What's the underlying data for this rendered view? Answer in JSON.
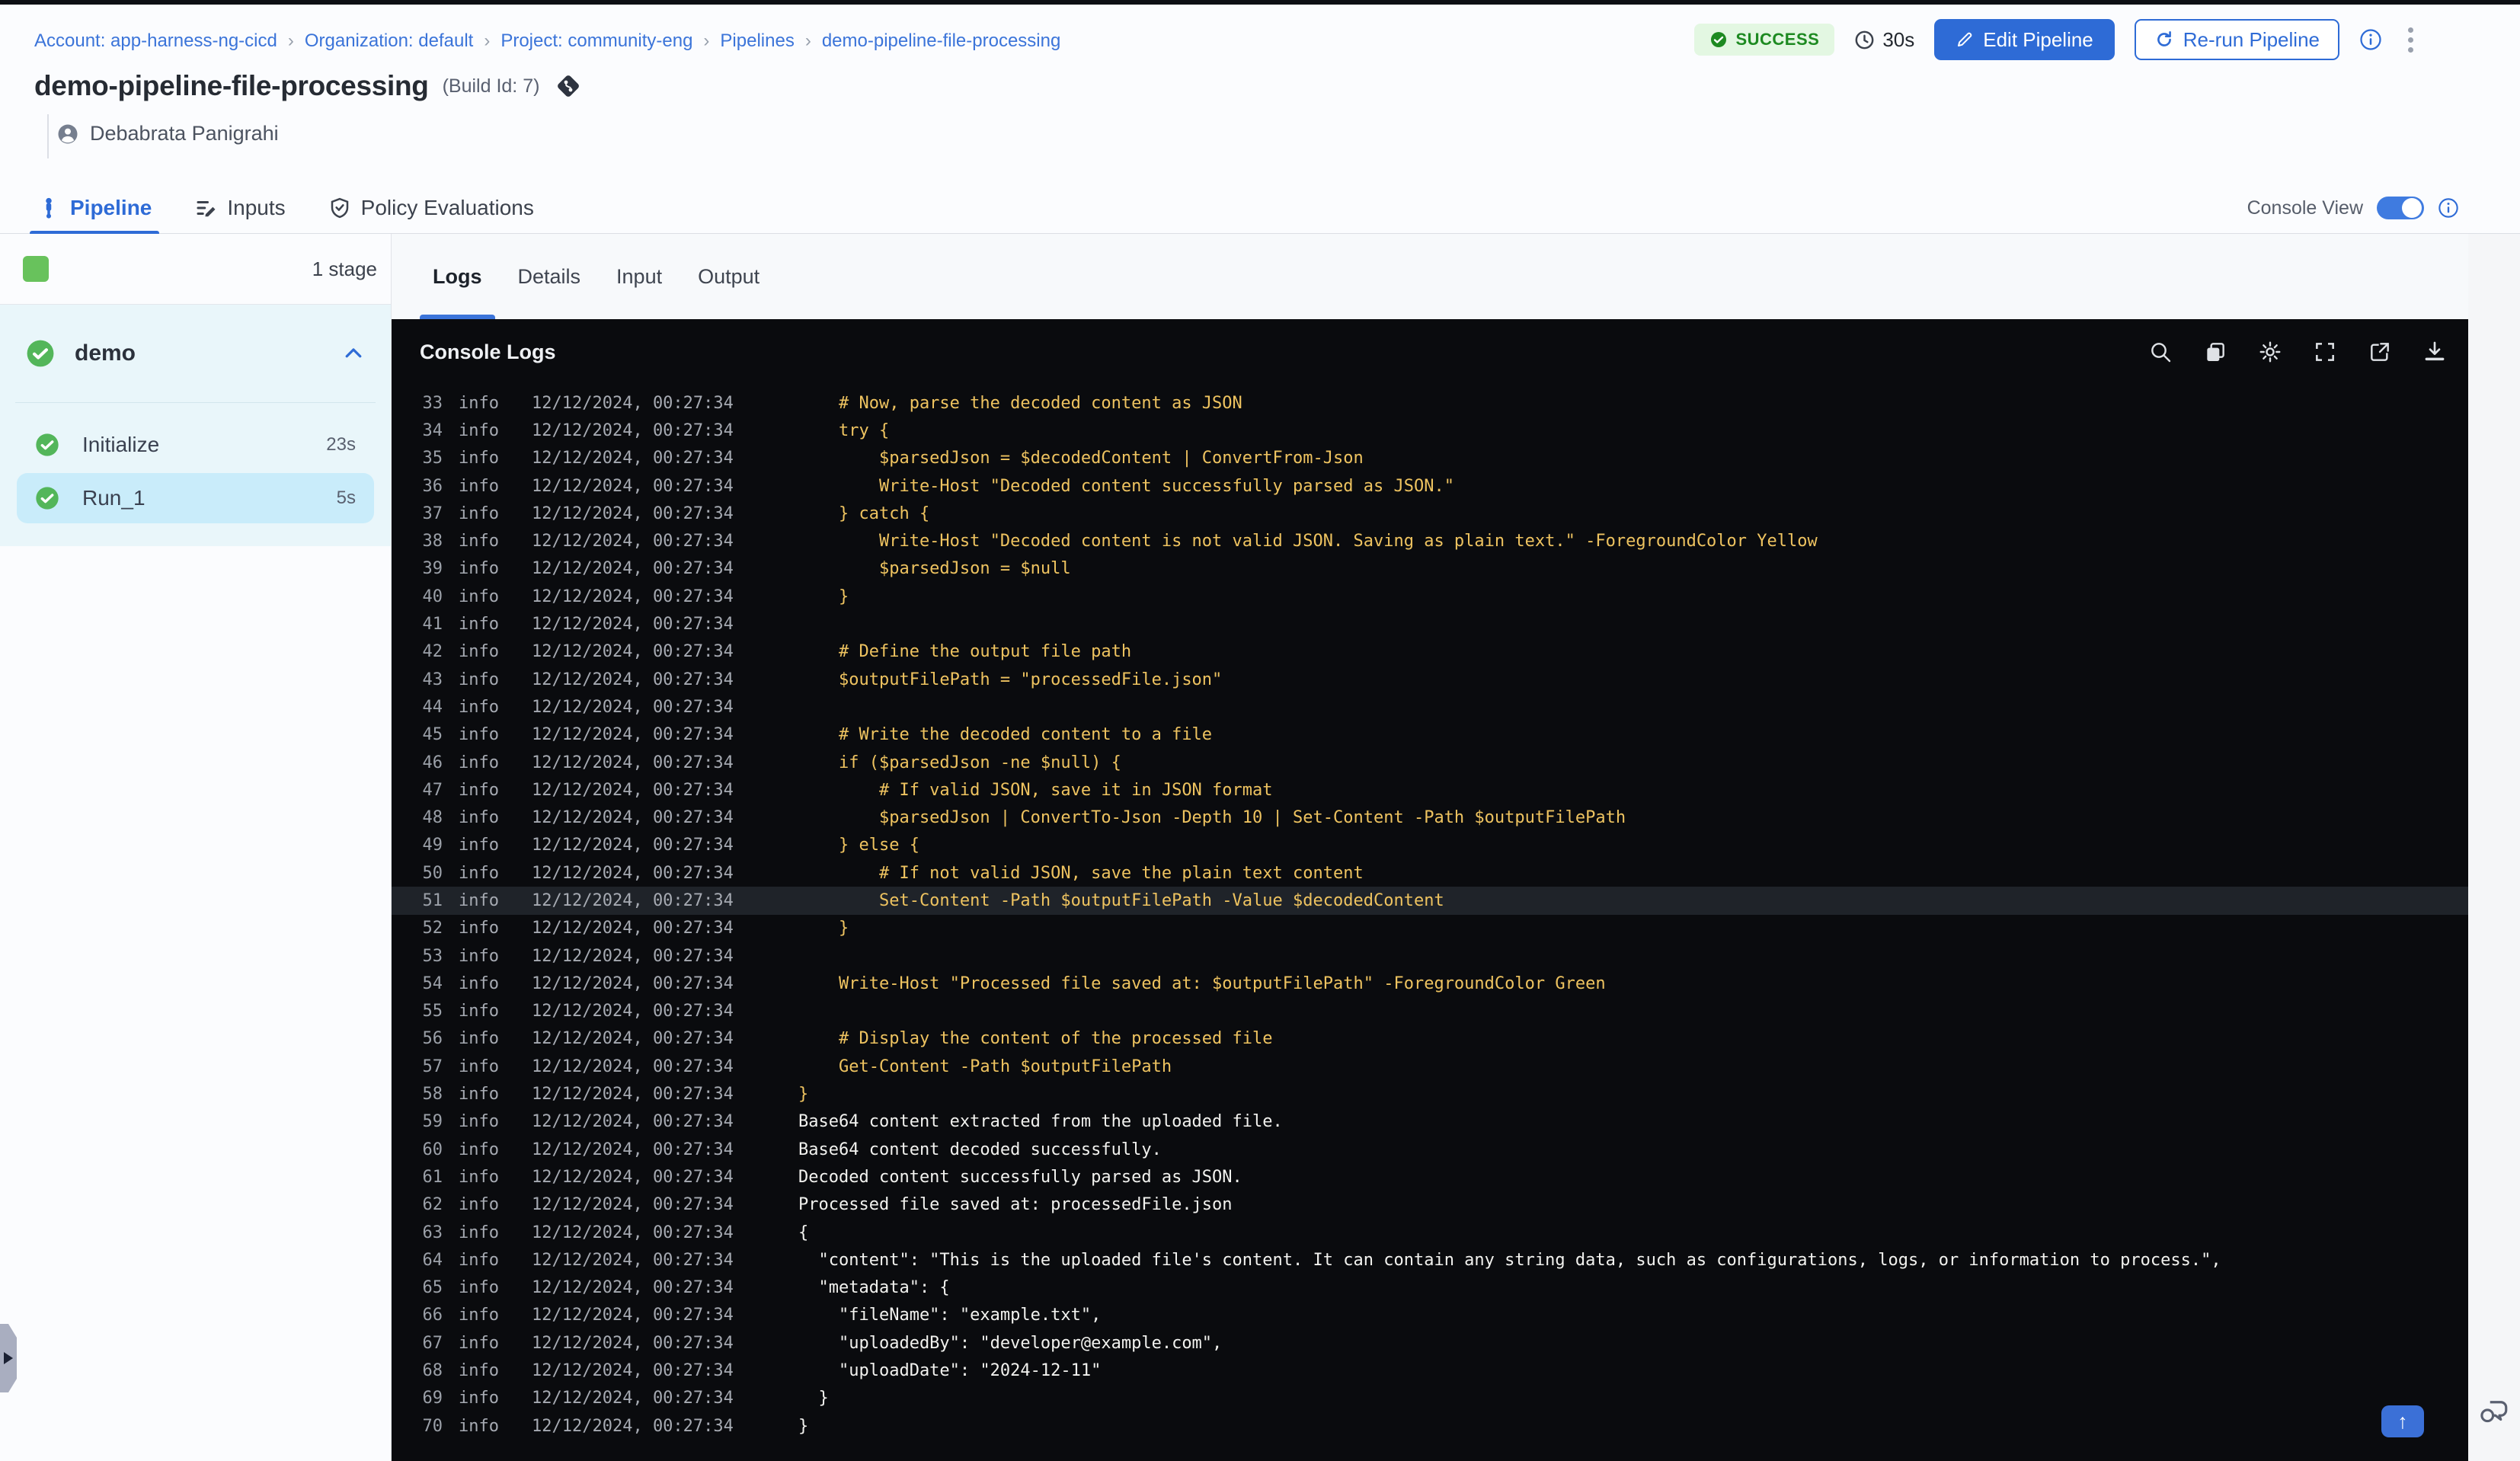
{
  "breadcrumb": [
    "Account: app-harness-ng-cicd",
    "Organization: default",
    "Project: community-eng",
    "Pipelines",
    "demo-pipeline-file-processing"
  ],
  "status": {
    "label": "SUCCESS",
    "duration": "30s"
  },
  "actions": {
    "edit": "Edit Pipeline",
    "rerun": "Re-run Pipeline"
  },
  "header": {
    "title": "demo-pipeline-file-processing",
    "build_id": "(Build Id: 7)",
    "author": "Debabrata Panigrahi"
  },
  "tabs": {
    "pipeline": "Pipeline",
    "inputs": "Inputs",
    "policy": "Policy Evaluations",
    "console_view_label": "Console View"
  },
  "sidebar": {
    "stage_count": "1 stage",
    "stage_name": "demo",
    "steps": [
      {
        "name": "Initialize",
        "duration": "23s",
        "selected": false
      },
      {
        "name": "Run_1",
        "duration": "5s",
        "selected": true
      }
    ]
  },
  "log_tabs": {
    "items": [
      "Logs",
      "Details",
      "Input",
      "Output"
    ],
    "active": "Logs"
  },
  "console": {
    "title": "Console Logs",
    "toolbar_icons": [
      "search",
      "copy",
      "settings",
      "fullscreen",
      "open-in-new",
      "download"
    ]
  },
  "colors": {
    "accent_blue": "#2e6bd6",
    "success_green": "#1d8a21",
    "step_check_green": "#53b65a",
    "console_bg": "#0a0b0e",
    "log_code": "#eec360",
    "log_plain": "#f2f2ef",
    "selected_step_bg": "#c9ecfa"
  },
  "logs": {
    "level": "info",
    "timestamp": "12/12/2024, 00:27:34",
    "lines": [
      {
        "n": 33,
        "kind": "code",
        "text": "    # Now, parse the decoded content as JSON"
      },
      {
        "n": 34,
        "kind": "code",
        "text": "    try {"
      },
      {
        "n": 35,
        "kind": "code",
        "text": "        $parsedJson = $decodedContent | ConvertFrom-Json"
      },
      {
        "n": 36,
        "kind": "code",
        "text": "        Write-Host \"Decoded content successfully parsed as JSON.\""
      },
      {
        "n": 37,
        "kind": "code",
        "text": "    } catch {"
      },
      {
        "n": 38,
        "kind": "code",
        "text": "        Write-Host \"Decoded content is not valid JSON. Saving as plain text.\" -ForegroundColor Yellow"
      },
      {
        "n": 39,
        "kind": "code",
        "text": "        $parsedJson = $null"
      },
      {
        "n": 40,
        "kind": "code",
        "text": "    }"
      },
      {
        "n": 41,
        "kind": "code",
        "text": ""
      },
      {
        "n": 42,
        "kind": "code",
        "text": "    # Define the output file path"
      },
      {
        "n": 43,
        "kind": "code",
        "text": "    $outputFilePath = \"processedFile.json\""
      },
      {
        "n": 44,
        "kind": "code",
        "text": ""
      },
      {
        "n": 45,
        "kind": "code",
        "text": "    # Write the decoded content to a file"
      },
      {
        "n": 46,
        "kind": "code",
        "text": "    if ($parsedJson -ne $null) {"
      },
      {
        "n": 47,
        "kind": "code",
        "text": "        # If valid JSON, save it in JSON format"
      },
      {
        "n": 48,
        "kind": "code",
        "text": "        $parsedJson | ConvertTo-Json -Depth 10 | Set-Content -Path $outputFilePath"
      },
      {
        "n": 49,
        "kind": "code",
        "text": "    } else {"
      },
      {
        "n": 50,
        "kind": "code",
        "text": "        # If not valid JSON, save the plain text content"
      },
      {
        "n": 51,
        "kind": "code",
        "text": "        Set-Content -Path $outputFilePath -Value $decodedContent",
        "highlight": true
      },
      {
        "n": 52,
        "kind": "code",
        "text": "    }"
      },
      {
        "n": 53,
        "kind": "code",
        "text": ""
      },
      {
        "n": 54,
        "kind": "code",
        "text": "    Write-Host \"Processed file saved at: $outputFilePath\" -ForegroundColor Green"
      },
      {
        "n": 55,
        "kind": "code",
        "text": ""
      },
      {
        "n": 56,
        "kind": "code",
        "text": "    # Display the content of the processed file"
      },
      {
        "n": 57,
        "kind": "code",
        "text": "    Get-Content -Path $outputFilePath"
      },
      {
        "n": 58,
        "kind": "code",
        "text": "}"
      },
      {
        "n": 59,
        "kind": "plain",
        "text": "Base64 content extracted from the uploaded file."
      },
      {
        "n": 60,
        "kind": "plain",
        "text": "Base64 content decoded successfully."
      },
      {
        "n": 61,
        "kind": "plain",
        "text": "Decoded content successfully parsed as JSON."
      },
      {
        "n": 62,
        "kind": "plain",
        "text": "Processed file saved at: processedFile.json"
      },
      {
        "n": 63,
        "kind": "plain",
        "text": "{"
      },
      {
        "n": 64,
        "kind": "plain",
        "text": "  \"content\": \"This is the uploaded file's content. It can contain any string data, such as configurations, logs, or information to process.\","
      },
      {
        "n": 65,
        "kind": "plain",
        "text": "  \"metadata\": {"
      },
      {
        "n": 66,
        "kind": "plain",
        "text": "    \"fileName\": \"example.txt\","
      },
      {
        "n": 67,
        "kind": "plain",
        "text": "    \"uploadedBy\": \"developer@example.com\","
      },
      {
        "n": 68,
        "kind": "plain",
        "text": "    \"uploadDate\": \"2024-12-11\""
      },
      {
        "n": 69,
        "kind": "plain",
        "text": "  }"
      },
      {
        "n": 70,
        "kind": "plain",
        "text": "}"
      }
    ]
  }
}
